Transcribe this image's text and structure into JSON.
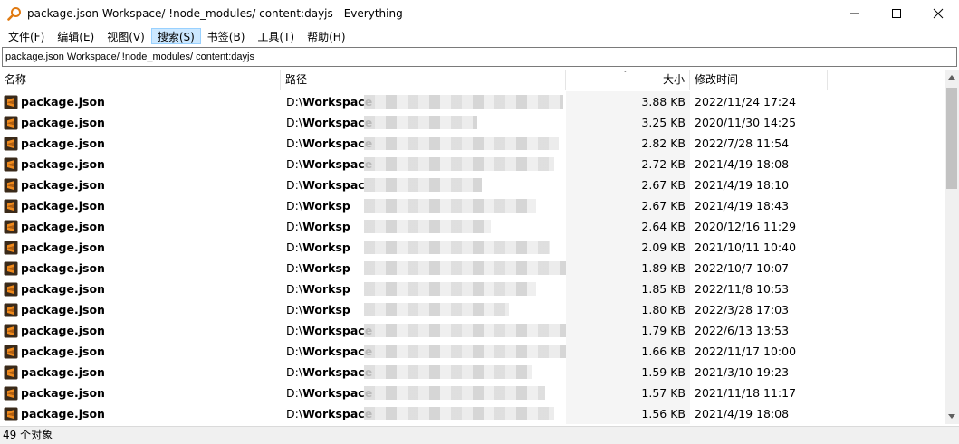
{
  "window": {
    "title": "package.json Workspace/ !node_modules/ content:dayjs - Everything",
    "icon": "magnifier-icon"
  },
  "menu": [
    {
      "label": "文件(F)"
    },
    {
      "label": "编辑(E)"
    },
    {
      "label": "视图(V)"
    },
    {
      "label": "搜索(S)",
      "active": true
    },
    {
      "label": "书签(B)"
    },
    {
      "label": "工具(T)"
    },
    {
      "label": "帮助(H)"
    }
  ],
  "search": {
    "value": "package.json Workspace/ !node_modules/ content:dayjs"
  },
  "columns": {
    "name": "名称",
    "path": "路径",
    "size": "大小",
    "date": "修改时间"
  },
  "rows": [
    {
      "name": "package.json",
      "path_prefix": "D:\\",
      "path_bold": "Workspace",
      "size": "3.88 KB",
      "date": "2022/11/24 17:24"
    },
    {
      "name": "package.json",
      "path_prefix": "D:\\",
      "path_bold": "Workspace",
      "size": "3.25 KB",
      "date": "2020/11/30 14:25"
    },
    {
      "name": "package.json",
      "path_prefix": "D:\\",
      "path_bold": "Workspace",
      "size": "2.82 KB",
      "date": "2022/7/28 11:54"
    },
    {
      "name": "package.json",
      "path_prefix": "D:\\",
      "path_bold": "Workspace",
      "size": "2.72 KB",
      "date": "2021/4/19 18:08"
    },
    {
      "name": "package.json",
      "path_prefix": "D:\\",
      "path_bold": "Workspac",
      "size": "2.67 KB",
      "date": "2021/4/19 18:10"
    },
    {
      "name": "package.json",
      "path_prefix": "D:\\",
      "path_bold": "Worksp",
      "size": "2.67 KB",
      "date": "2021/4/19 18:43"
    },
    {
      "name": "package.json",
      "path_prefix": "D:\\",
      "path_bold": "Worksp",
      "size": "2.64 KB",
      "date": "2020/12/16 11:29"
    },
    {
      "name": "package.json",
      "path_prefix": "D:\\",
      "path_bold": "Worksp",
      "size": "2.09 KB",
      "date": "2021/10/11 10:40"
    },
    {
      "name": "package.json",
      "path_prefix": "D:\\",
      "path_bold": "Worksp",
      "size": "1.89 KB",
      "date": "2022/10/7 10:07"
    },
    {
      "name": "package.json",
      "path_prefix": "D:\\",
      "path_bold": "Worksp",
      "size": "1.85 KB",
      "date": "2022/11/8 10:53"
    },
    {
      "name": "package.json",
      "path_prefix": "D:\\",
      "path_bold": "Worksp",
      "size": "1.80 KB",
      "date": "2022/3/28 17:03"
    },
    {
      "name": "package.json",
      "path_prefix": "D:\\",
      "path_bold": "Workspace",
      "size": "1.79 KB",
      "date": "2022/6/13 13:53"
    },
    {
      "name": "package.json",
      "path_prefix": "D:\\",
      "path_bold": "Workspace",
      "size": "1.66 KB",
      "date": "2022/11/17 10:00"
    },
    {
      "name": "package.json",
      "path_prefix": "D:\\",
      "path_bold": "Workspace",
      "size": "1.59 KB",
      "date": "2021/3/10 19:23"
    },
    {
      "name": "package.json",
      "path_prefix": "D:\\",
      "path_bold": "Workspace",
      "size": "1.57 KB",
      "date": "2021/11/18 11:17"
    },
    {
      "name": "package.json",
      "path_prefix": "D:\\",
      "path_bold": "Workspace",
      "size": "1.56 KB",
      "date": "2021/4/19 18:08"
    }
  ],
  "status": {
    "text": "49 个对象"
  },
  "colors": {
    "file_icon_bg": "#3a2a1a",
    "file_icon_fg": "#f08a1c",
    "menu_active_bg": "#cce8ff"
  }
}
